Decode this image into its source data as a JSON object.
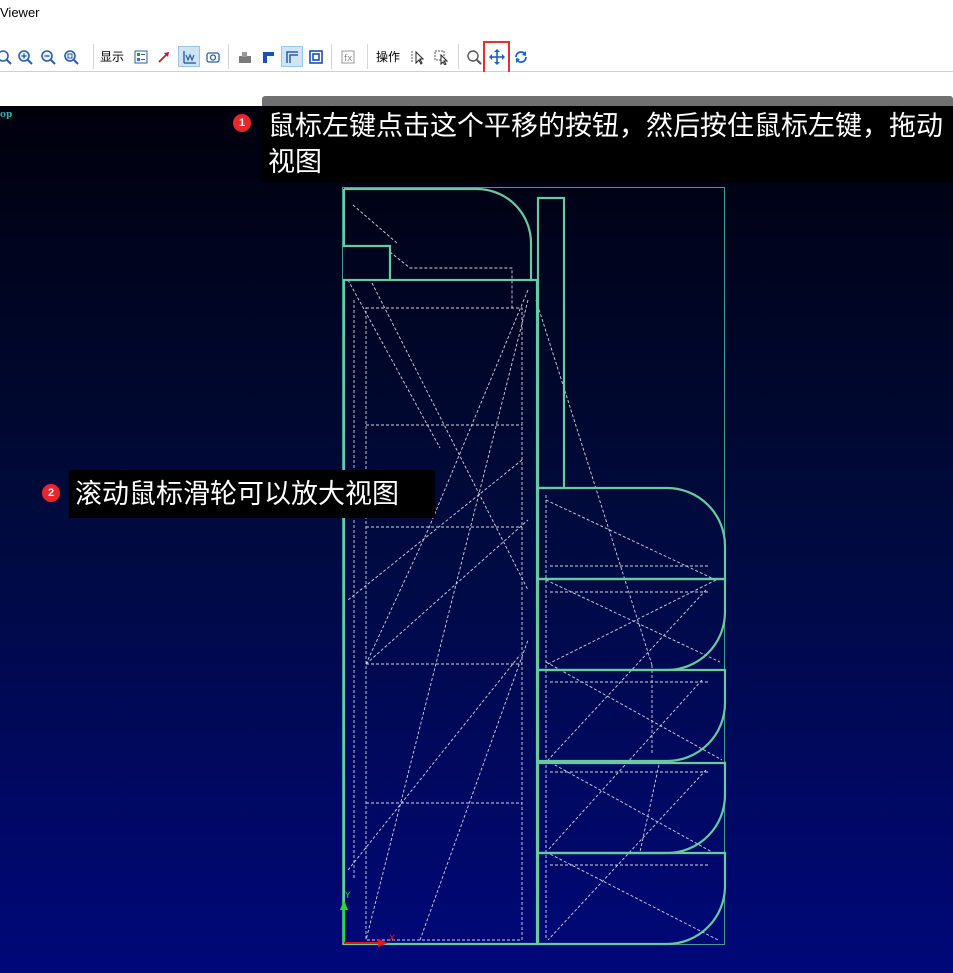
{
  "window": {
    "title": "Viewer"
  },
  "toolbar": {
    "display_label": "显示",
    "operation_label": "操作",
    "icons": [
      "zoom-in-icon",
      "zoom-out-icon",
      "zoom-fit-icon",
      "zoom-window-icon",
      "layer-icon",
      "arrow-icon",
      "axis-icon",
      "camera-icon",
      "part-icon",
      "corner-icon",
      "frame-icon",
      "square-icon",
      "fx-icon",
      "select-icon",
      "box-select-icon",
      "zoom-tool-icon",
      "pan-icon",
      "rotate-icon"
    ]
  },
  "viewport": {
    "view_label": "op"
  },
  "annotations": {
    "step1": {
      "badge": "1",
      "text": "鼠标左键点击这个平移的按钮，然后按住鼠标左键，拖动视图"
    },
    "step2": {
      "badge": "2",
      "text": "滚动鼠标滑轮可以放大视图"
    }
  },
  "colors": {
    "model_line": "#66c6a0",
    "dashed_line": "#d0d0d0",
    "highlight": "#e53030",
    "badge": "#e8262b"
  }
}
